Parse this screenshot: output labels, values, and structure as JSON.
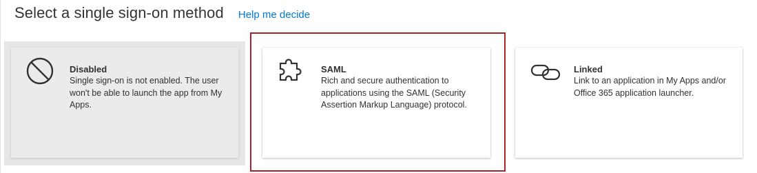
{
  "header": {
    "title": "Select a single sign-on method",
    "help_link": "Help me decide"
  },
  "colors": {
    "link": "#0078d4",
    "selected_outline": "#a4262c",
    "disabled_background": "#e6e6e6",
    "text": "#323130"
  },
  "methods": [
    {
      "title": "Disabled",
      "description": "Single sign-on is not enabled. The user won't be able to launch the app from My Apps.",
      "icon": "prohibited-icon",
      "state": "disabled"
    },
    {
      "title": "SAML",
      "description": "Rich and secure authentication to applications using the SAML (Security Assertion Markup Language) protocol.",
      "icon": "puzzle-piece-icon",
      "state": "selected"
    },
    {
      "title": "Linked",
      "description": "Link to an application in My Apps and/or Office 365 application launcher.",
      "icon": "link-icon",
      "state": "available"
    }
  ]
}
